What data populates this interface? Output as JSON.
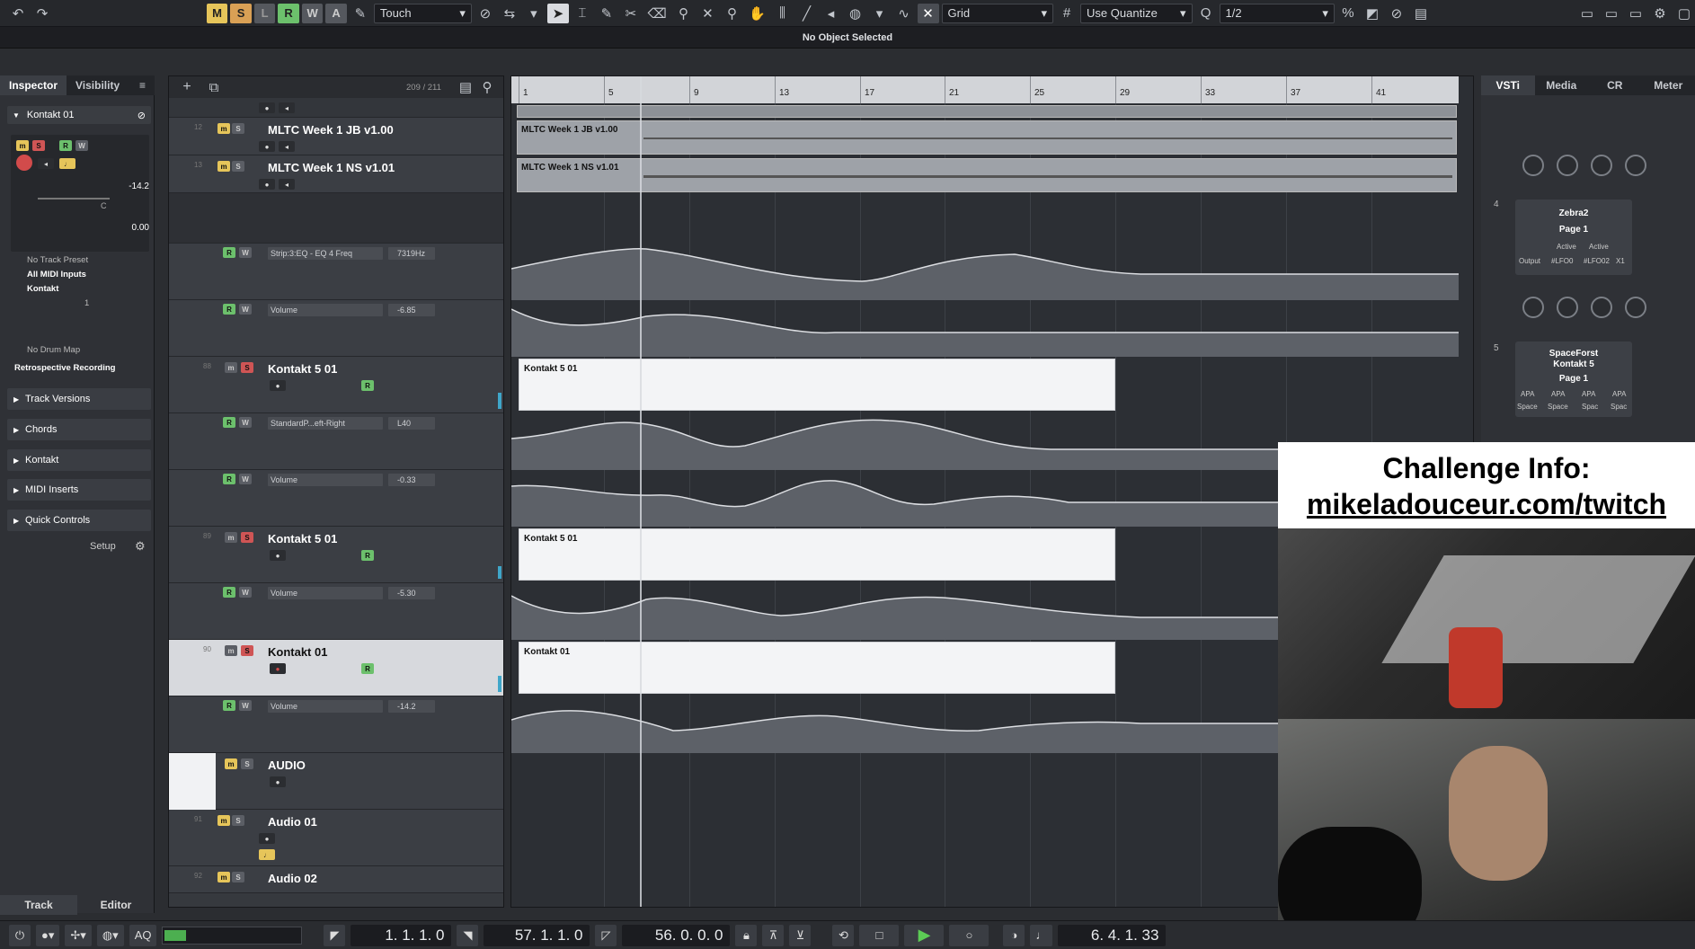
{
  "toolbar": {
    "states": [
      "M",
      "S",
      "L",
      "R",
      "W",
      "A"
    ],
    "state_colors": [
      "#e6c55a",
      "#d9a055",
      "#8a8d93",
      "#6cc06c",
      "#8a8d93",
      "#8a8d93"
    ],
    "automation_mode": "Touch",
    "snap_type": "Grid",
    "quantize_mode": "Use Quantize",
    "quantize_value": "1/2"
  },
  "status": {
    "text": "No Object Selected"
  },
  "inspector": {
    "tabs": [
      "Inspector",
      "Visibility"
    ],
    "track_name": "Kontakt 01",
    "volume": "-14.2",
    "pan": "C",
    "delay": "0.00",
    "rows": [
      "No Track Preset",
      "All MIDI Inputs",
      "Kontakt",
      "1",
      "No Drum Map",
      "Retrospective Recording"
    ],
    "sections": [
      "Track Versions",
      "Chords",
      "Kontakt",
      "MIDI Inserts",
      "Quick Controls"
    ],
    "setup": "Setup",
    "bottom_tabs": [
      "Track",
      "Editor"
    ]
  },
  "tracklist": {
    "count": "209 / 211",
    "tracks": [
      {
        "num": "12",
        "name": "MLTC Week 1 JB v1.00"
      },
      {
        "num": "13",
        "name": "MLTC Week 1 NS v1.01"
      },
      {
        "num": "88",
        "name": "Kontakt 5 01"
      },
      {
        "num": "89",
        "name": "Kontakt 5 01"
      },
      {
        "num": "90",
        "name": "Kontakt 01"
      },
      {
        "num": "",
        "name": "AUDIO"
      },
      {
        "num": "91",
        "name": "Audio 01"
      },
      {
        "num": "92",
        "name": "Audio 02"
      }
    ],
    "lanes": [
      {
        "param": "Strip:3:EQ - EQ 4 Freq",
        "value": "7319Hz"
      },
      {
        "param": "Volume",
        "value": "-6.85"
      },
      {
        "param": "StandardP...eft-Right",
        "value": "L40"
      },
      {
        "param": "Volume",
        "value": "-0.33"
      },
      {
        "param": "Volume",
        "value": "-5.30"
      },
      {
        "param": "Volume",
        "value": "-14.2"
      }
    ]
  },
  "arrange": {
    "ruler": [
      "1",
      "5",
      "9",
      "13",
      "17",
      "21",
      "25",
      "29",
      "33",
      "37",
      "41"
    ],
    "parts": {
      "audio1": "MLTC Week 1 JB v1.00",
      "audio2": "MLTC Week 1 NS v1.01",
      "k1": "Kontakt 5 01",
      "k2": "Kontakt 5 01",
      "k3": "Kontakt 01"
    }
  },
  "rightzone": {
    "tabs": [
      "VSTi",
      "Media",
      "CR",
      "Meter"
    ],
    "slots": [
      {
        "num": "4",
        "name": "Zebra2",
        "page": "Page 1",
        "labels": [
          "Active",
          "Active",
          "Output",
          "#LFO0",
          "#LFO02",
          "X1"
        ]
      },
      {
        "num": "5",
        "name": "SpaceForst\nKontakt 5",
        "page": "Page 1",
        "labels": [
          "APA",
          "APA",
          "APA",
          "APA",
          "Space",
          "Space",
          "Spac",
          "Spac"
        ]
      }
    ]
  },
  "overlay": {
    "line1": "Challenge Info:",
    "line2": "mikeladouceur.com/twitch"
  },
  "transport": {
    "left_locator": "1. 1. 1.    0",
    "right_locator": "57. 1. 1.    0",
    "length": "56. 0. 0.    0",
    "position": "6. 4. 1. 33",
    "aq": "AQ"
  }
}
